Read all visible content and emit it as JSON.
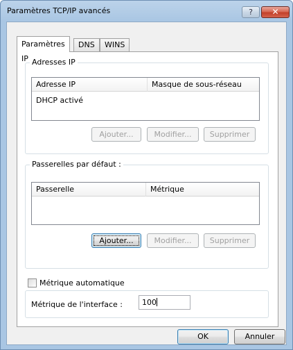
{
  "window": {
    "title": "Paramètres TCP/IP avancés",
    "help_glyph": "?",
    "close_glyph": "✕"
  },
  "tabs": [
    {
      "label": "Paramètres IP",
      "active": true
    },
    {
      "label": "DNS",
      "active": false
    },
    {
      "label": "WINS",
      "active": false
    }
  ],
  "ip_addresses": {
    "group_title": "Adresses IP",
    "columns": [
      "Adresse IP",
      "Masque de sous-réseau"
    ],
    "rows": [
      "DHCP activé"
    ],
    "buttons": {
      "add": "Ajouter...",
      "edit": "Modifier...",
      "remove": "Supprimer"
    }
  },
  "gateways": {
    "group_title": "Passerelles par défaut :",
    "columns": [
      "Passerelle",
      "Métrique"
    ],
    "rows": [],
    "buttons": {
      "add": "Ajouter...",
      "edit": "Modifier...",
      "remove": "Supprimer"
    }
  },
  "auto_metric": {
    "label": "Métrique automatique",
    "checked": false
  },
  "interface_metric": {
    "label": "Métrique de l'interface :",
    "value": "100"
  },
  "footer": {
    "ok": "OK",
    "cancel": "Annuler"
  }
}
